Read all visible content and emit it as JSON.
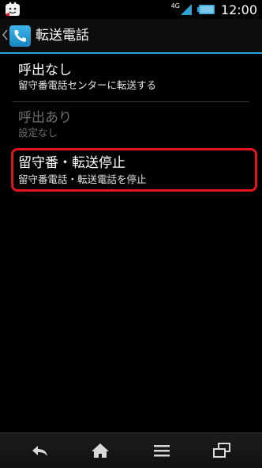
{
  "status_bar": {
    "network_type": "4G",
    "time": "12:00",
    "icons": [
      "app-notification-icon",
      "signal-icon",
      "battery-icon"
    ]
  },
  "title_bar": {
    "title": "転送電話",
    "icons": [
      "back-chevron-icon",
      "phone-icon"
    ],
    "accent_color": "#2fa2d6"
  },
  "list": {
    "items": [
      {
        "title": "呼出なし",
        "subtitle": "留守番電話センターに転送する",
        "enabled": true
      },
      {
        "title": "呼出あり",
        "subtitle": "設定なし",
        "enabled": false
      },
      {
        "title": "留守番・転送停止",
        "subtitle": "留守番電話・転送電話を停止",
        "enabled": true,
        "highlighted": true
      }
    ],
    "highlight_color": "#e3141b"
  },
  "nav_bar": {
    "buttons": [
      "back-icon",
      "home-icon",
      "menu-icon",
      "recent-apps-icon"
    ]
  }
}
